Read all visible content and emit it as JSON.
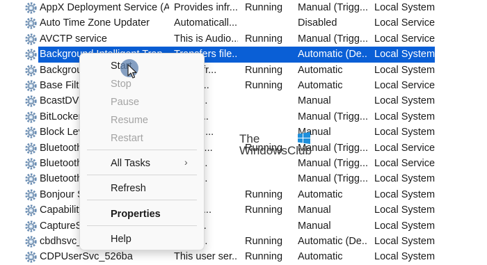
{
  "rows": [
    {
      "name": "AppX Deployment Service (A...",
      "desc": "Provides infr...",
      "status": "Running",
      "start": "Manual (Trigg...",
      "logon": "Local System"
    },
    {
      "name": "Auto Time Zone Updater",
      "desc": "Automaticall...",
      "status": "",
      "start": "Disabled",
      "logon": "Local Service"
    },
    {
      "name": "AVCTP service",
      "desc": "This is Audio...",
      "status": "Running",
      "start": "Manual (Trigg...",
      "logon": "Local Service"
    },
    {
      "name": "Background Intelligent Tran...",
      "desc": "Transfers file...",
      "status": "",
      "start": "Automatic (De...",
      "logon": "Local System"
    },
    {
      "name": "Background",
      "desc": "ows infr...",
      "status": "Running",
      "start": "Automatic",
      "logon": "Local System"
    },
    {
      "name": "Base Filter",
      "desc": "se Filt...",
      "status": "Running",
      "start": "Automatic",
      "logon": "Local Service"
    },
    {
      "name": "BcastDVR",
      "desc": "er ser...",
      "status": "",
      "start": "Manual",
      "logon": "Local System"
    },
    {
      "name": "BitLocker",
      "desc": "C hos...",
      "status": "",
      "start": "Manual (Trigg...",
      "logon": "Local System"
    },
    {
      "name": "Block Lev",
      "desc": "BENGI...",
      "status": "",
      "start": "Manual",
      "logon": "Local System"
    },
    {
      "name": "Bluetooth",
      "desc": "e supp...",
      "status": "Running",
      "start": "Manual (Trigg...",
      "logon": "Local Service"
    },
    {
      "name": "Bluetooth",
      "desc": "uetoo...",
      "status": "",
      "start": "Manual (Trigg...",
      "logon": "Local Service"
    },
    {
      "name": "Bluetooth",
      "desc": "uetoo...",
      "status": "",
      "start": "Manual (Trigg...",
      "logon": "Local System"
    },
    {
      "name": "Bonjour S",
      "desc": "s har...",
      "status": "Running",
      "start": "Automatic",
      "logon": "Local System"
    },
    {
      "name": "Capability",
      "desc": "es faci...",
      "status": "Running",
      "start": "Manual",
      "logon": "Local System"
    },
    {
      "name": "CaptureS",
      "desc": "s opti...",
      "status": "",
      "start": "Manual",
      "logon": "Local System"
    },
    {
      "name": "cbdhsvc_",
      "desc": "er ser...",
      "status": "Running",
      "start": "Automatic (De...",
      "logon": "Local System"
    },
    {
      "name": "CDPUserSvc_526ba",
      "desc": "This user ser...",
      "status": "Running",
      "start": "Automatic",
      "logon": "Local System"
    }
  ],
  "selected_row_index": 3,
  "context_menu": {
    "items": [
      {
        "label": "Start",
        "enabled": true
      },
      {
        "label": "Stop",
        "enabled": false
      },
      {
        "label": "Pause",
        "enabled": false
      },
      {
        "label": "Resume",
        "enabled": false
      },
      {
        "label": "Restart",
        "enabled": false
      },
      {
        "label": "All Tasks",
        "enabled": true,
        "submenu": true
      },
      {
        "label": "Refresh",
        "enabled": true
      },
      {
        "label": "Properties",
        "enabled": true,
        "bold": true
      },
      {
        "label": "Help",
        "enabled": true
      }
    ]
  },
  "icons": {
    "row_icon": "gear-icon",
    "submenu": "chevron-right-icon",
    "pointer": "mouse-cursor-icon"
  },
  "colors": {
    "selection": "#0a5fd6",
    "menu_bg": "#f9f9f9",
    "disabled_text": "#a4a4a4"
  },
  "watermark": {
    "line1": "The",
    "line2": "WindowsClub"
  }
}
